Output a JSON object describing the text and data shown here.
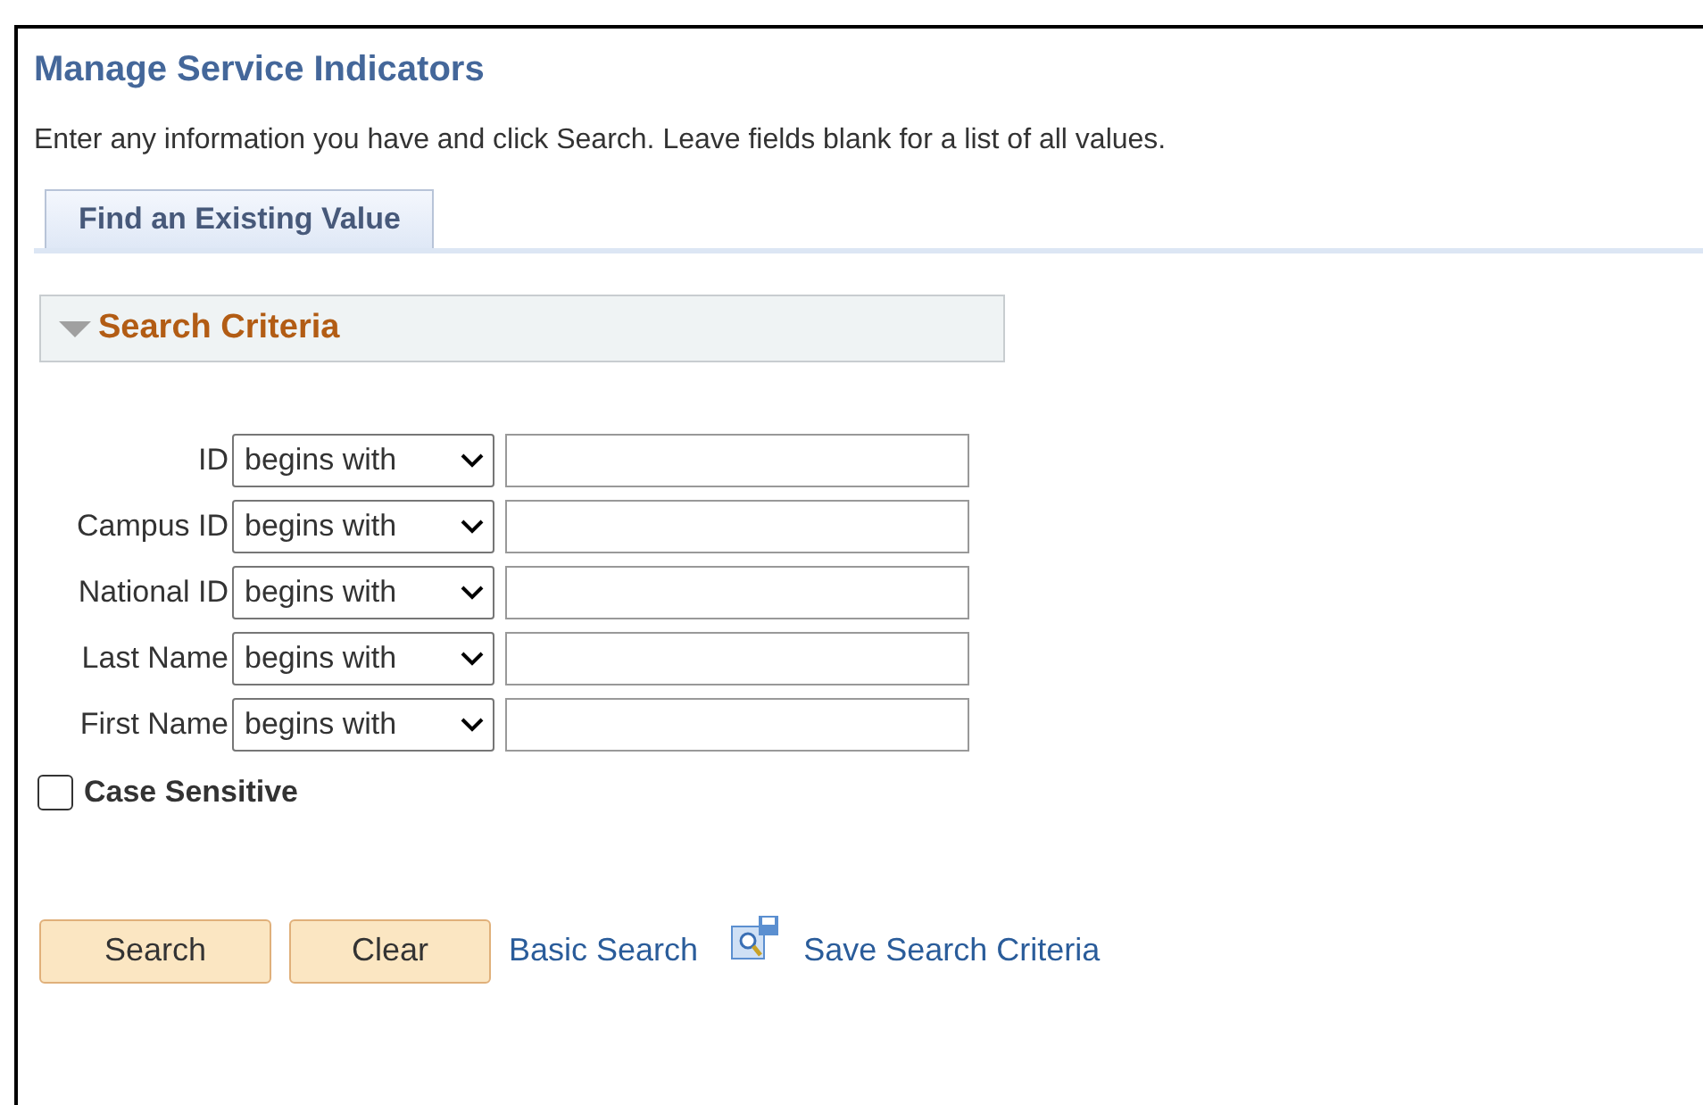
{
  "title": "Manage Service Indicators",
  "instructions": "Enter any information you have and click Search. Leave fields blank for a list of all values.",
  "tabs": [
    {
      "label": "Find an Existing Value",
      "selected": true
    }
  ],
  "search_criteria": {
    "title": "Search Criteria",
    "expanded": true
  },
  "fields": [
    {
      "label": "ID",
      "operator": "begins with"
    },
    {
      "label": "Campus ID",
      "operator": "begins with"
    },
    {
      "label": "National ID",
      "operator": "begins with"
    },
    {
      "label": "Last Name",
      "operator": "begins with"
    },
    {
      "label": "First Name",
      "operator": "begins with"
    }
  ],
  "case_sensitive": {
    "label": "Case Sensitive",
    "checked": false
  },
  "buttons": [
    "Search",
    "Clear"
  ],
  "links": {
    "basic_search": "Basic Search",
    "save_search": "Save Search Criteria"
  }
}
